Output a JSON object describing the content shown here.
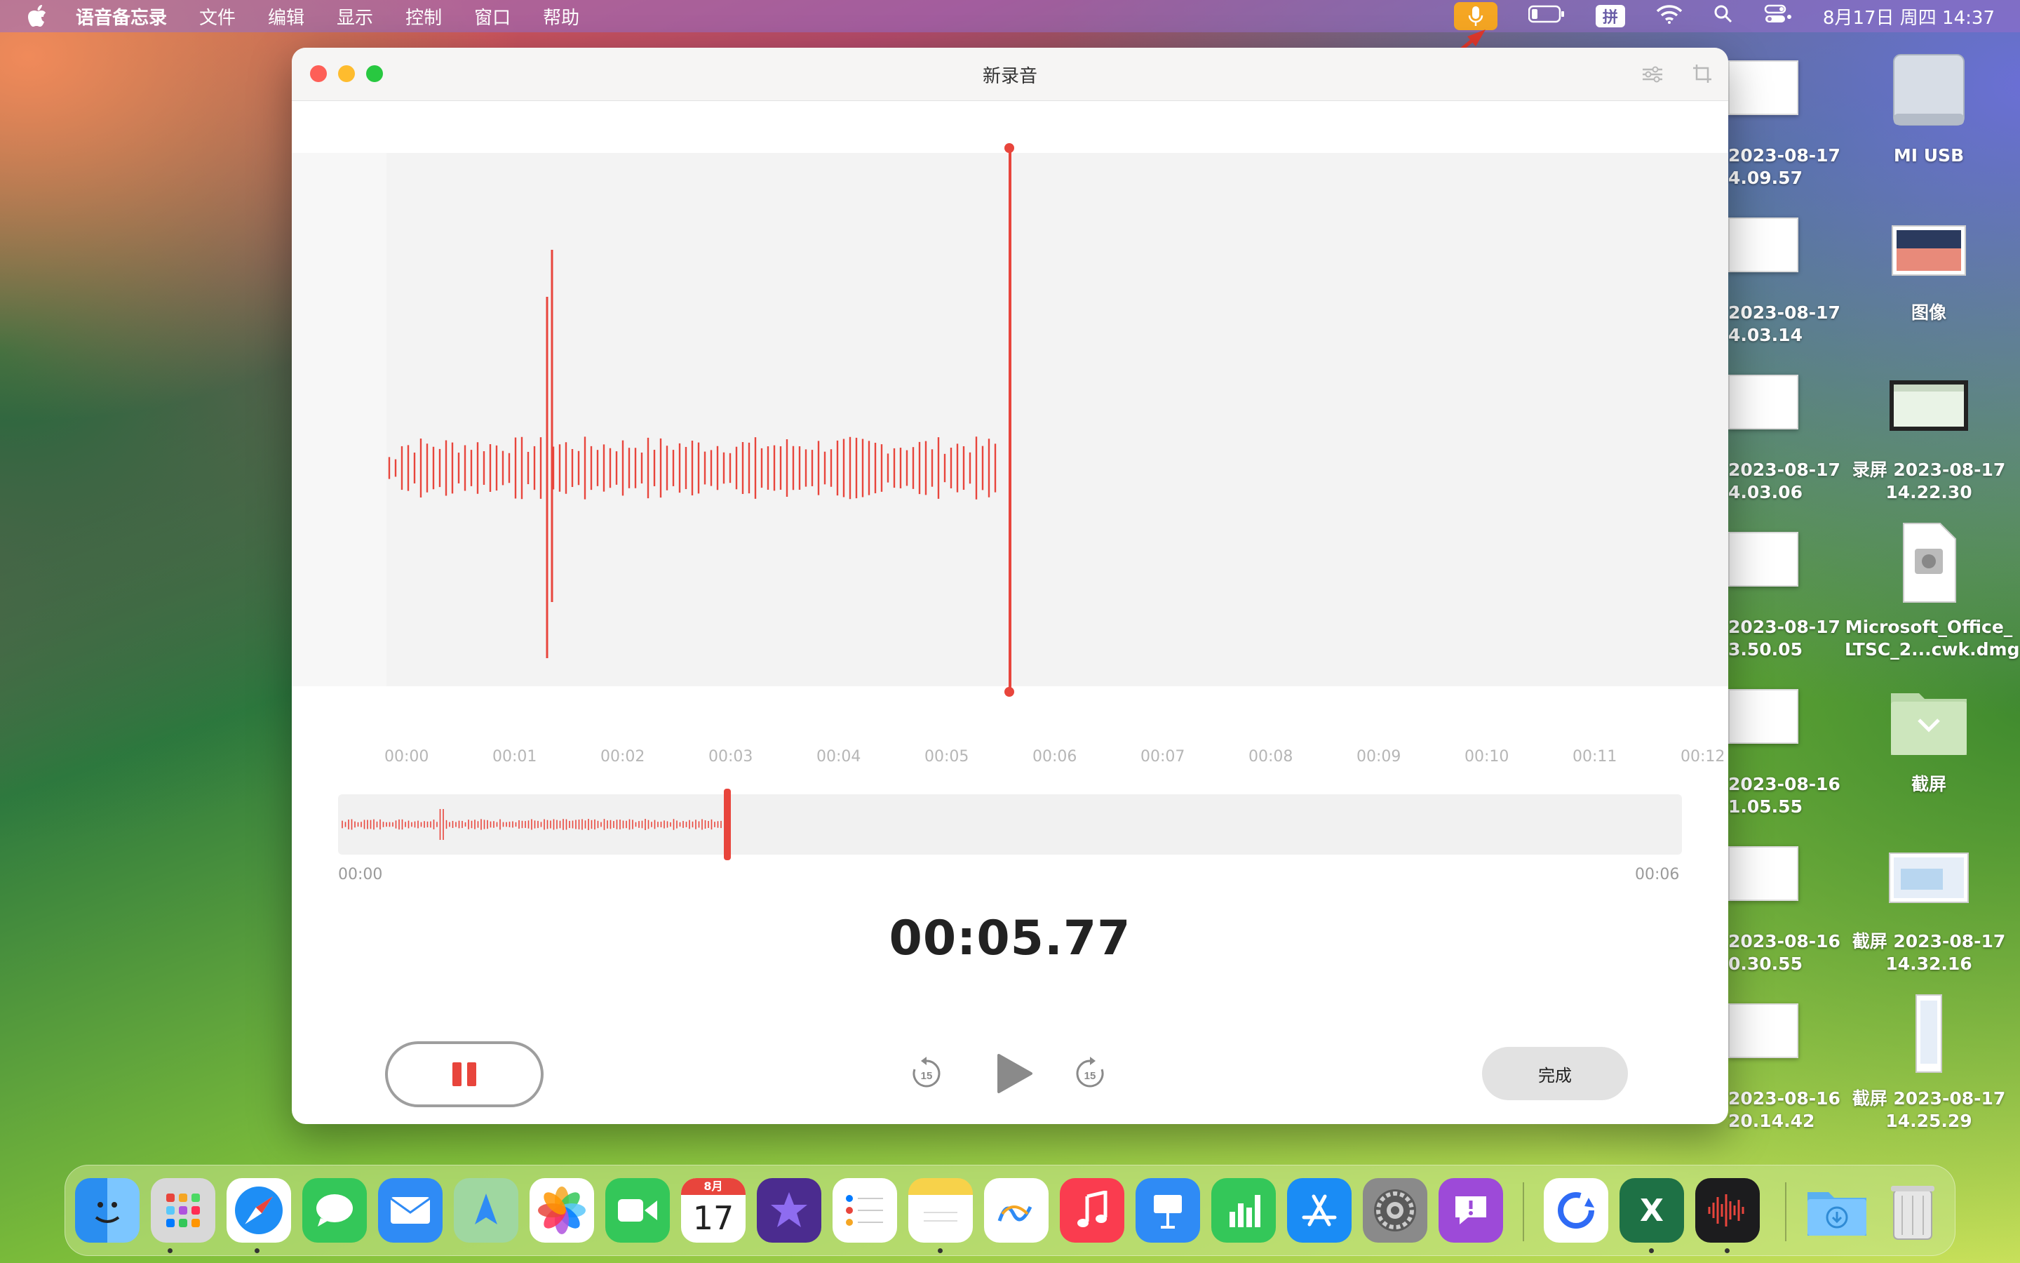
{
  "menubar": {
    "app_name": "语音备忘录",
    "items": [
      "文件",
      "编辑",
      "显示",
      "控制",
      "窗口",
      "帮助"
    ],
    "clock": "8月17日 周四  14:37",
    "input_method": "拼"
  },
  "window": {
    "title": "新录音",
    "timeline_ticks": [
      "00:00",
      "00:01",
      "00:02",
      "00:03",
      "00:04",
      "00:05",
      "00:06",
      "00:07",
      "00:08",
      "00:09",
      "00:10",
      "00:11",
      "00:12"
    ],
    "overview_start": "00:00",
    "overview_end": "00:06",
    "elapsed": "00:05.77",
    "done_label": "完成",
    "skip_seconds": "15"
  },
  "desktop": {
    "items": [
      {
        "line1": "2023-08-17",
        "line2": "4.09.57"
      },
      {
        "line1": "2023-08-17",
        "line2": "4.03.14"
      },
      {
        "line1": "2023-08-17",
        "line2": "4.03.06"
      },
      {
        "line1": "2023-08-17",
        "line2": "3.50.05"
      },
      {
        "line1": "2023-08-16",
        "line2": "1.05.55"
      },
      {
        "line1": "2023-08-16",
        "line2": "0.30.55"
      },
      {
        "line1": "2023-08-16",
        "line2": "20.14.42"
      }
    ],
    "right_items": [
      {
        "line1": "MI USB",
        "line2": ""
      },
      {
        "line1": "图像",
        "line2": ""
      },
      {
        "line1": "录屏 2023-08-17",
        "line2": "14.22.30"
      },
      {
        "line1": "Microsoft_Office_",
        "line2": "LTSC_2...cwk.dmg"
      },
      {
        "line1": "截屏",
        "line2": ""
      },
      {
        "line1": "截屏 2023-08-17",
        "line2": "14.32.16"
      },
      {
        "line1": "截屏 2023-08-17",
        "line2": "14.25.29"
      }
    ]
  },
  "dock": {
    "calendar_month": "8月",
    "calendar_day": "17"
  },
  "colors": {
    "accent_red": "#e8453c",
    "mic_orange": "#f5a623"
  }
}
